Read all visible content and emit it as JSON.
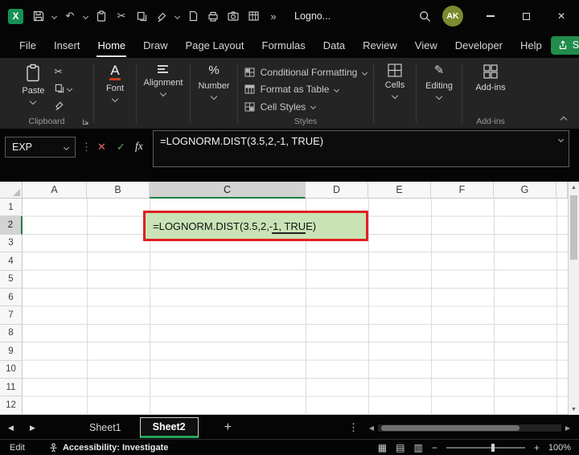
{
  "app": {
    "title": "Logno...",
    "avatar": "AK"
  },
  "menu": {
    "tabs": [
      "File",
      "Insert",
      "Home",
      "Draw",
      "Page Layout",
      "Formulas",
      "Data",
      "Review",
      "View",
      "Developer",
      "Help"
    ],
    "active_tab": "Home",
    "share": "Share"
  },
  "ribbon": {
    "paste": "Paste",
    "font": "Font",
    "font_glyph": "A",
    "alignment": "Alignment",
    "number": "Number",
    "number_glyph": "%",
    "styles": {
      "conditional_formatting": "Conditional Formatting",
      "format_as_table": "Format as Table",
      "cell_styles": "Cell Styles",
      "group_label": "Styles"
    },
    "cells": "Cells",
    "editing": "Editing",
    "addins": "Add-ins",
    "clipboard_group_label": "Clipboard",
    "addins_group_label": "Add-ins"
  },
  "formula_bar": {
    "name_box": "EXP",
    "fx": "fx",
    "formula": "=LOGNORM.DIST(3.5,2,-1, TRUE)"
  },
  "grid": {
    "columns": [
      "A",
      "B",
      "C",
      "D",
      "E",
      "F",
      "G"
    ],
    "rows": [
      "1",
      "2",
      "3",
      "4",
      "5",
      "6",
      "7",
      "8",
      "9",
      "10",
      "11",
      "12"
    ],
    "selected_column": "C",
    "selected_row": "2",
    "active_cell": {
      "ref": "C2",
      "text": "=LOGNORM.DIST(3.5,2,-1, TRUE)"
    }
  },
  "sheets": {
    "tab1": "Sheet1",
    "tab2": "Sheet2",
    "active": "Sheet2",
    "add": "+"
  },
  "status": {
    "mode": "Edit",
    "accessibility": "Accessibility: Investigate",
    "zoom": "100%"
  },
  "colors": {
    "accent_green": "#21a366",
    "share_button": "#218c4b",
    "annotation_red": "#e02020",
    "cell_fill_green": "#c9e3b6",
    "avatar_bg": "#7d8a2e"
  },
  "icons": {
    "title_bar": [
      "excel-logo",
      "save",
      "undo",
      "clipboard",
      "scissors",
      "copy",
      "format-painter",
      "document",
      "printer",
      "camera",
      "table",
      "more-commands",
      "search",
      "minimize",
      "maximize",
      "close"
    ],
    "formula_bar": [
      "drag-handle",
      "cancel",
      "enter",
      "function-fx"
    ],
    "status_bar": [
      "accessibility-person",
      "normal-view",
      "page-layout-view",
      "page-break-view",
      "zoom-out",
      "zoom-in"
    ]
  }
}
